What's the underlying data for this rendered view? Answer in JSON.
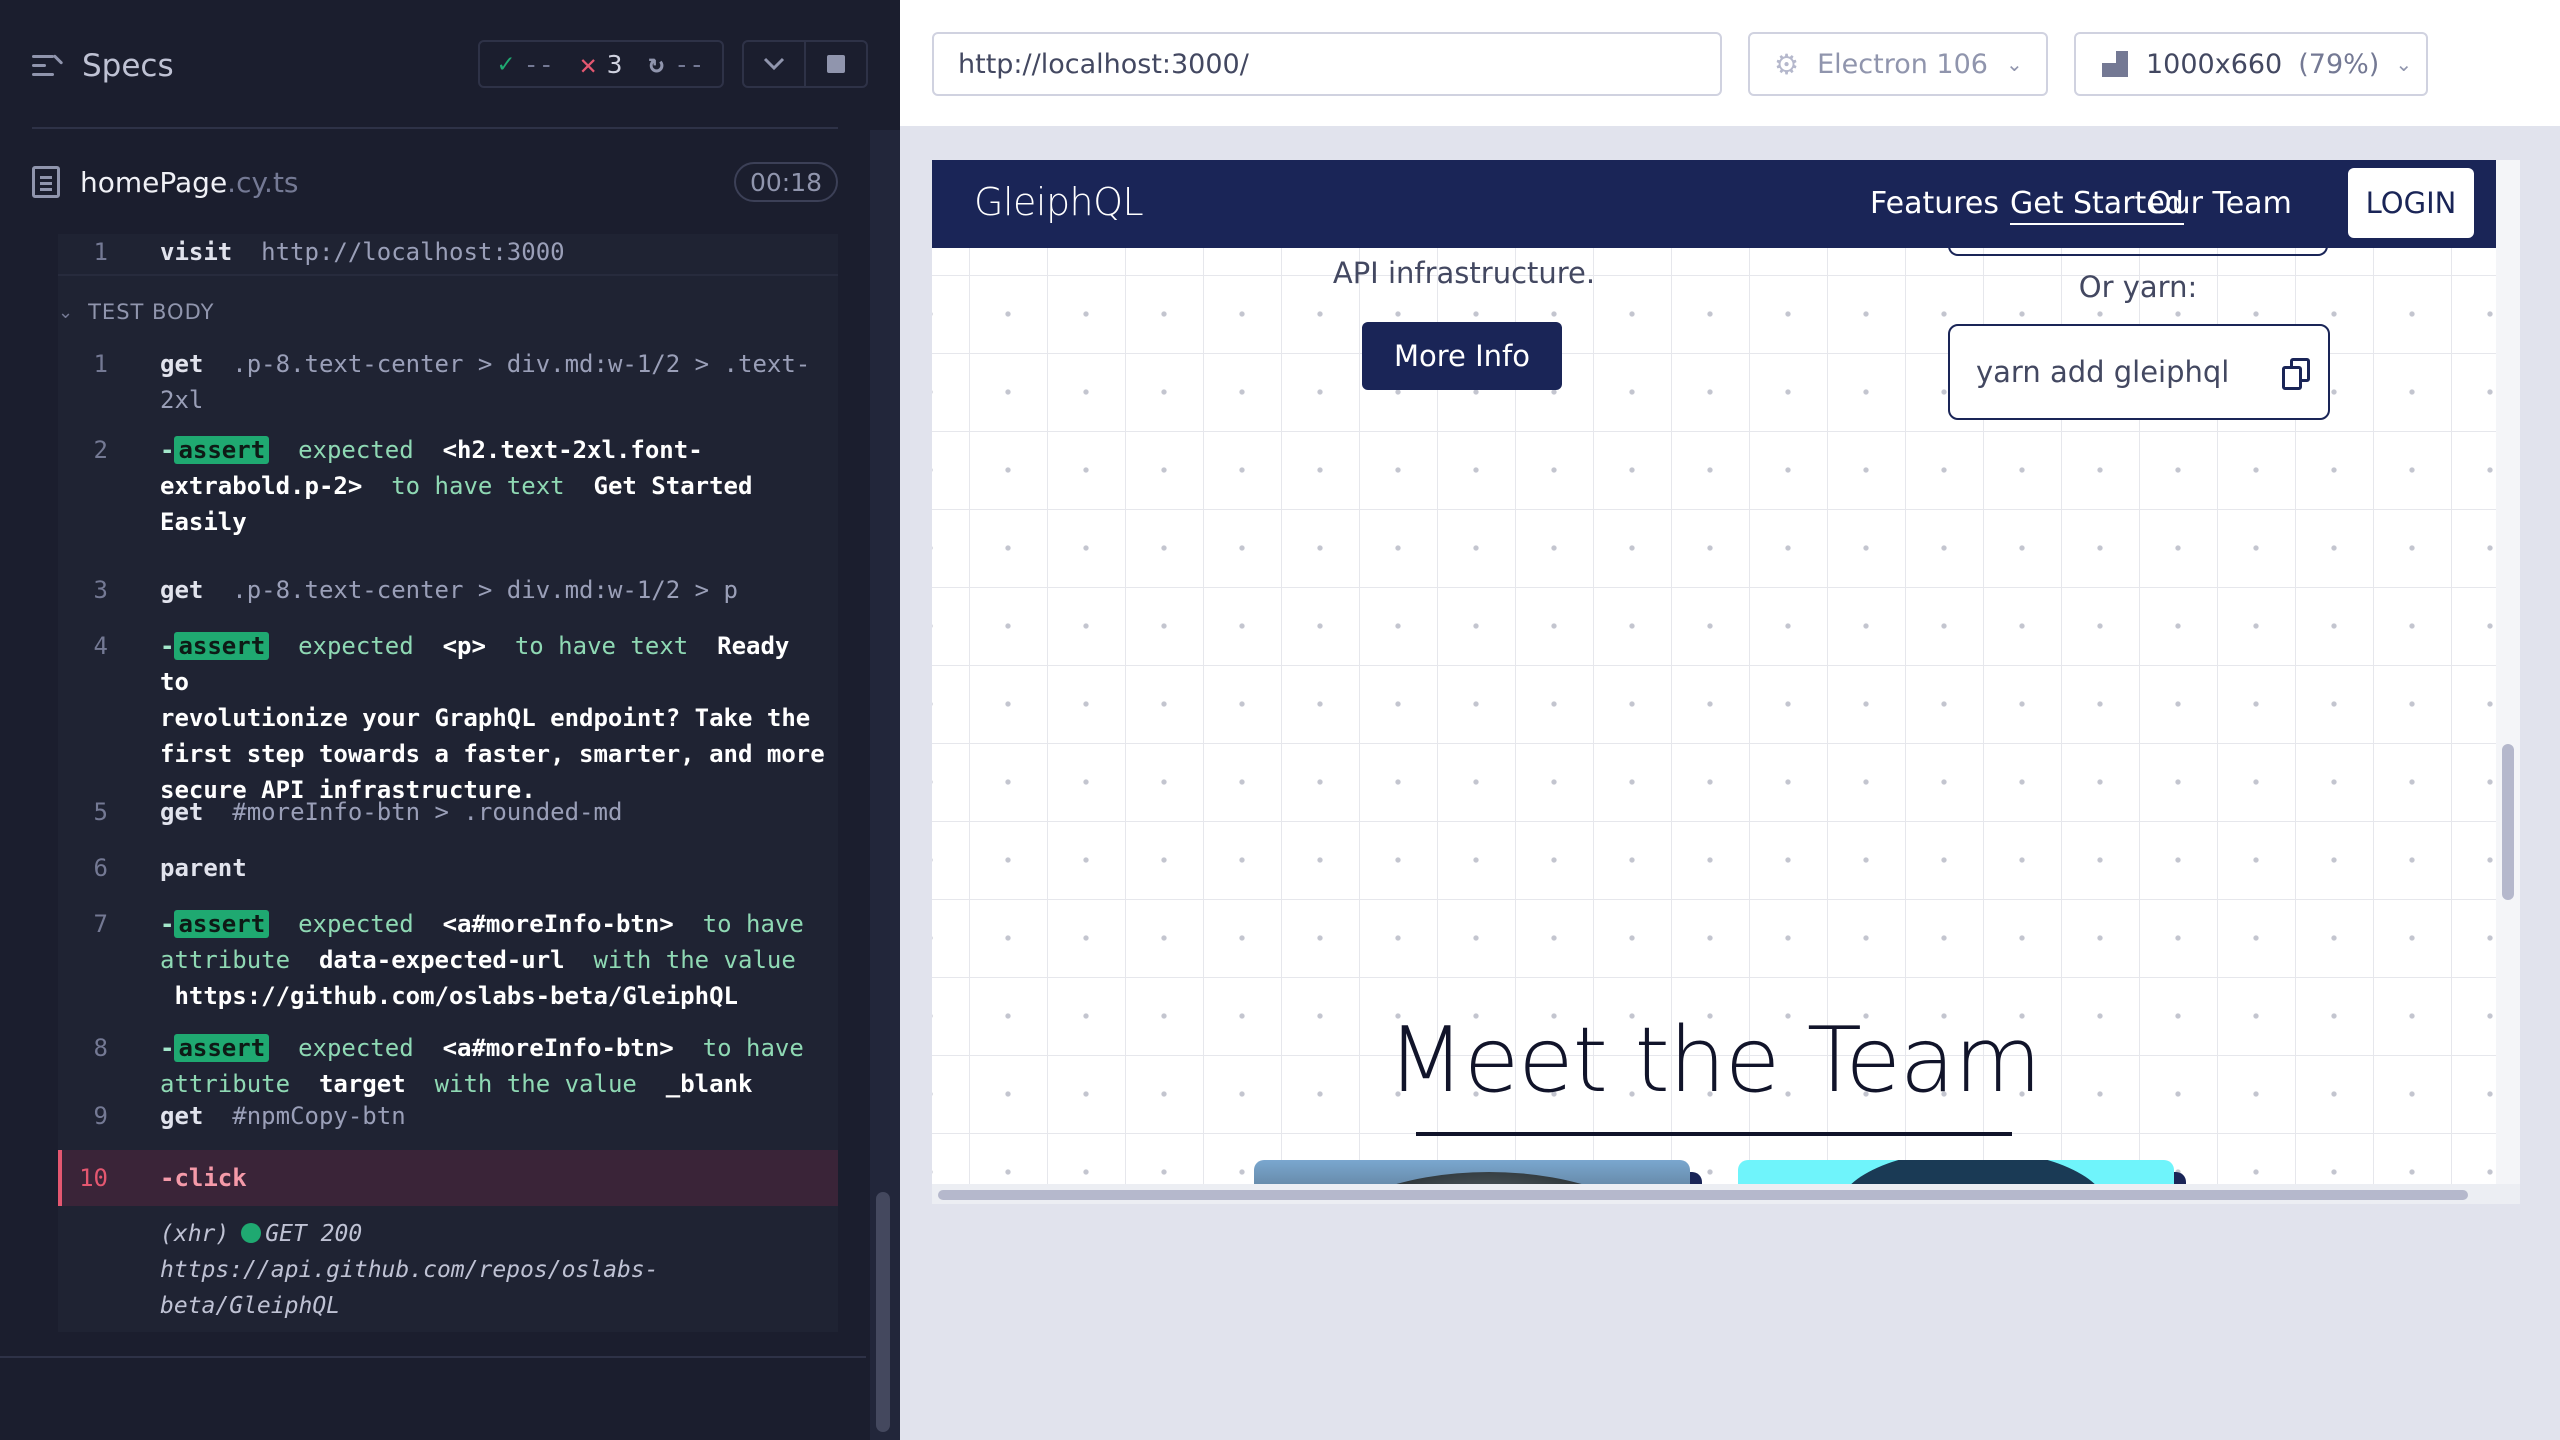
{
  "runner": {
    "title": "Specs",
    "stats": {
      "passed": "--",
      "failed": "3",
      "pending": "--"
    },
    "spec": {
      "name": "homePage",
      "ext": ".cy.ts",
      "duration": "00:18"
    },
    "section_label": "TEST BODY",
    "visit": {
      "num": "1",
      "cmd": "visit",
      "arg": "http://localhost:3000"
    },
    "commands": [
      {
        "num": "1",
        "cmd": "get",
        "arg": ".p-8.text-center > div.md:w-1/2 > .text-",
        "arg2": "2xl"
      },
      {
        "num": "2",
        "badge": "assert",
        "l1a": "expected",
        "l1b": "<h2.text-2xl.font-",
        "l2a": "extrabold.p-2>",
        "l2b": "to have text",
        "l2c": "Get Started",
        "l3": "Easily"
      },
      {
        "num": "3",
        "cmd": "get",
        "arg": ".p-8.text-center > div.md:w-1/2 > p"
      },
      {
        "num": "4",
        "badge": "assert",
        "l1a": "expected",
        "l1b": "<p>",
        "l1c": "to have text",
        "l1d": "Ready to",
        "l2": "revolutionize your GraphQL endpoint? Take the",
        "l3": "first step towards a faster, smarter, and more",
        "l4": "secure API infrastructure."
      },
      {
        "num": "5",
        "cmd": "get",
        "arg": "#moreInfo-btn > .rounded-md"
      },
      {
        "num": "6",
        "cmd": "parent"
      },
      {
        "num": "7",
        "badge": "assert",
        "l1a": "expected",
        "l1b": "<a#moreInfo-btn>",
        "l1c": "to have",
        "l2a": "attribute",
        "l2b": "data-expected-url",
        "l2c": "with the value",
        "l3": "https://github.com/oslabs-beta/GleiphQL"
      },
      {
        "num": "8",
        "badge": "assert",
        "l1a": "expected",
        "l1b": "<a#moreInfo-btn>",
        "l1c": "to have",
        "l2a": "attribute",
        "l2b": "target",
        "l2c": "with the value",
        "l2d": "_blank"
      },
      {
        "num": "9",
        "cmd": "get",
        "arg": "#npmCopy-btn"
      },
      {
        "num": "10",
        "cmd": "click"
      }
    ],
    "xhr": {
      "tag": "(xhr)",
      "status": "GET 200",
      "url1": "https://api.github.com/repos/oslabs-",
      "url2": "beta/GleiphQL"
    }
  },
  "preview": {
    "url": "http://localhost:3000/",
    "browser": "Electron 106",
    "viewport": "1000x660",
    "scale": "(79%)"
  },
  "app": {
    "logo": "GleiphQL",
    "nav": {
      "features": "Features",
      "get_started": "Get Started",
      "our_team": "Our Team",
      "login": "LOGIN"
    },
    "api_text": "API infrastructure.",
    "more_info": "More Info",
    "or_yarn": "Or yarn:",
    "yarn_cmd": "yarn add gleiphql",
    "team_heading": "Meet the Team"
  },
  "colors": {
    "brand_navy": "#1a2557",
    "pass_green": "#1fa971",
    "fail_red": "#e45770",
    "card_cyan": "#6ff4fb"
  }
}
